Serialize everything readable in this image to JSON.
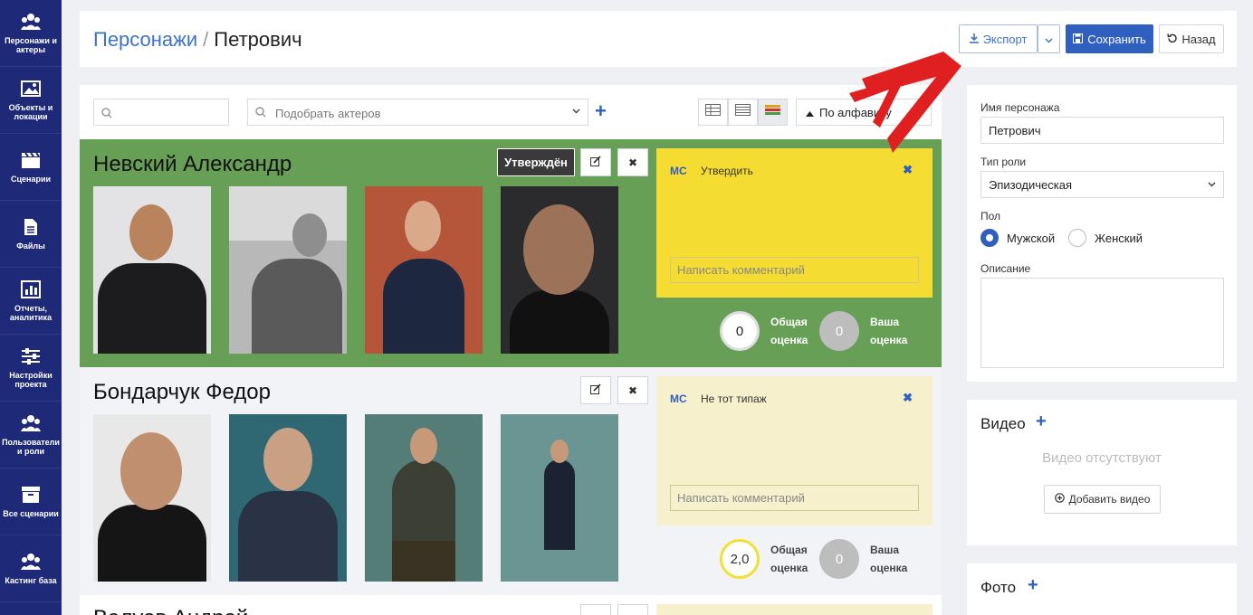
{
  "sidebar": {
    "items": [
      {
        "label": "Персонажи и актеры",
        "icon": "users-icon"
      },
      {
        "label": "Объекты и локации",
        "icon": "image-icon"
      },
      {
        "label": "Сценарии",
        "icon": "clapperboard-icon"
      },
      {
        "label": "Файлы",
        "icon": "file-icon"
      },
      {
        "label": "Отчеты, аналитика",
        "icon": "chart-icon"
      },
      {
        "label": "Настройки проекта",
        "icon": "sliders-icon"
      },
      {
        "label": "Пользователи и роли",
        "icon": "users-icon"
      },
      {
        "label": "Все сценарии",
        "icon": "archive-icon"
      },
      {
        "label": "Кастинг база",
        "icon": "users-icon"
      }
    ]
  },
  "header": {
    "breadcrumb_link": "Персонажи",
    "breadcrumb_sep": "/",
    "breadcrumb_current": "Петрович",
    "export_label": "Экспорт",
    "save_label": "Сохранить",
    "back_label": "Назад"
  },
  "toolbar": {
    "search_placeholder": "",
    "picker_placeholder": "Подобрать актеров",
    "sort_label": "По алфавиту"
  },
  "actors": [
    {
      "name": "Невский Александр",
      "status": "Утверждён",
      "comment_author": "МС",
      "comment_text": "Утвердить",
      "comment_placeholder": "Написать комментарий",
      "overall_score": "0",
      "overall_label_1": "Общая",
      "overall_label_2": "оценка",
      "my_score": "0",
      "my_label_1": "Ваша",
      "my_label_2": "оценка"
    },
    {
      "name": "Бондарчук Федор",
      "status": "",
      "comment_author": "МС",
      "comment_text": "Не тот типаж",
      "comment_placeholder": "Написать комментарий",
      "overall_score": "2,0",
      "overall_label_1": "Общая",
      "overall_label_2": "оценка",
      "my_score": "0",
      "my_label_1": "Ваша",
      "my_label_2": "оценка"
    },
    {
      "name": "Валуев Андрей"
    }
  ],
  "character_form": {
    "name_label": "Имя персонажа",
    "name_value": "Петрович",
    "role_type_label": "Тип роли",
    "role_type_value": "Эпизодическая",
    "gender_label": "Пол",
    "gender_male": "Мужской",
    "gender_female": "Женский",
    "gender_selected": "Мужской",
    "description_label": "Описание",
    "description_value": ""
  },
  "video_panel": {
    "title": "Видео",
    "empty_text": "Видео отсутствуют",
    "add_label": "Добавить видео"
  },
  "photo_panel": {
    "title": "Фото"
  },
  "colors": {
    "sidebar": "#1e2a78",
    "accent": "#2f5fbf",
    "approved_row": "#689f57",
    "approved_comment": "#f5dc32",
    "default_comment": "#f6f0cc",
    "annotation_arrow": "#e02020"
  }
}
